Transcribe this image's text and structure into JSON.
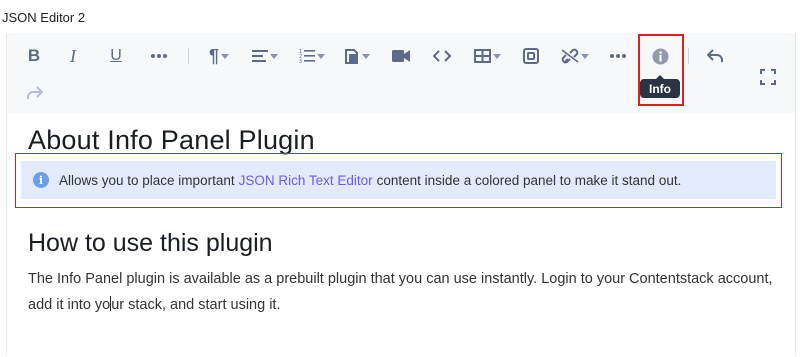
{
  "field": {
    "label": "JSON Editor 2"
  },
  "toolbar": {
    "tooltip": "Info",
    "buttons": [
      {
        "name": "bold-button",
        "icon": "bold-icon"
      },
      {
        "name": "italic-button",
        "icon": "italic-icon"
      },
      {
        "name": "underline-button",
        "icon": "underline-icon"
      },
      {
        "name": "more-formatting-button",
        "icon": "more-icon"
      },
      {
        "name": "paragraph-button",
        "icon": "paragraph-icon"
      },
      {
        "name": "alignment-button",
        "icon": "align-left-icon"
      },
      {
        "name": "list-button",
        "icon": "ordered-list-icon"
      },
      {
        "name": "copy-button",
        "icon": "copy-icon"
      },
      {
        "name": "video-button",
        "icon": "video-icon"
      },
      {
        "name": "code-button",
        "icon": "code-icon"
      },
      {
        "name": "table-button",
        "icon": "table-icon"
      },
      {
        "name": "embed-button",
        "icon": "embed-icon"
      },
      {
        "name": "link-button",
        "icon": "link-icon"
      },
      {
        "name": "more-insert-button",
        "icon": "more-icon"
      },
      {
        "name": "info-button",
        "icon": "info-icon"
      },
      {
        "name": "undo-button",
        "icon": "undo-icon"
      },
      {
        "name": "fullscreen-button",
        "icon": "fullscreen-icon"
      },
      {
        "name": "redo-button",
        "icon": "redo-icon"
      }
    ]
  },
  "content": {
    "heading1": "About Info Panel Plugin",
    "info_panel": {
      "before": "Allows you to place important",
      "link": "JSON Rich Text Editor",
      "after": "content inside a colored panel to make it stand out."
    },
    "heading2": "How to use this plugin",
    "paragraph_before_cursor": "The Info Panel plugin is available as a prebuilt plugin that you can use instantly. Login to your Contentstack account, add it into yo",
    "paragraph_after_cursor": "ur stack, and start using it."
  },
  "colors": {
    "accent": "#6c5ce7",
    "panel_bg": "#e1ebfb",
    "panel_icon": "#6aa1e6",
    "highlight_border": "#e02020",
    "toolbar_bg": "#f7f8fa",
    "icon_color": "#5d6a8a"
  }
}
